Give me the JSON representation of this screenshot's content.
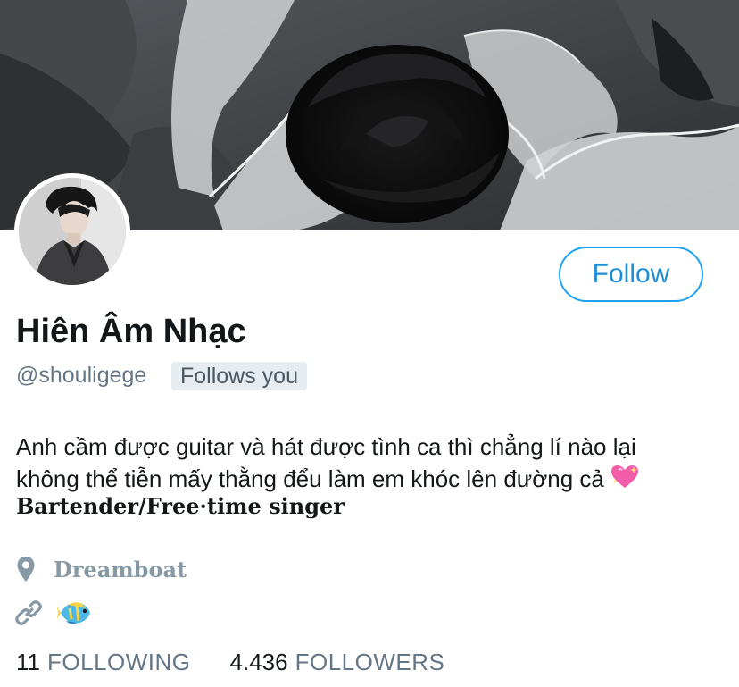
{
  "profile": {
    "display_name": "Hiên Âm Nhạc",
    "handle": "@shouligege",
    "follows_you_badge": "Follows you",
    "follow_button": "Follow",
    "bio_line_1": "Anh cầm được guitar và hát được tình ca thì chẳng lí nào lại",
    "bio_line_2": "không thể tiễn mấy thằng đểu làm em khóc lên đường cả",
    "bio_line_3": "Bartender/Free·time singer",
    "location": "Dreamboat",
    "location_icon": "map-pin-icon",
    "link_icon": "link-icon",
    "link_emoji_icon": "tropical-fish-icon",
    "bio_emoji_icon": "sparkling-heart-icon"
  },
  "stats": {
    "following_count": "11",
    "following_label": "FOLLOWING",
    "followers_count": "4.436",
    "followers_label": "FOLLOWERS"
  },
  "colors": {
    "accent": "#1da1f2",
    "secondary_text": "#657786",
    "badge_bg": "#e6ecf0"
  }
}
